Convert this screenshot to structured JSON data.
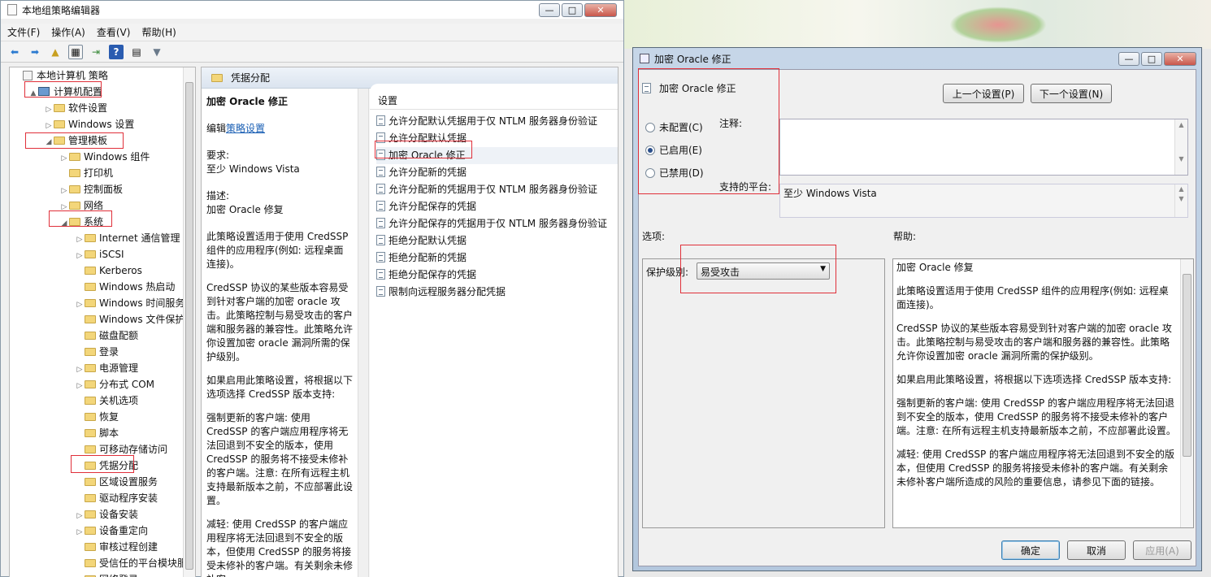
{
  "left_window": {
    "title": "本地组策略编辑器",
    "menu": [
      "文件(F)",
      "操作(A)",
      "查看(V)",
      "帮助(H)"
    ]
  },
  "tree": {
    "items": [
      {
        "label": "本地计算机 策略",
        "level": 0,
        "exp": ""
      },
      {
        "label": "计算机配置",
        "level": 1,
        "exp": "▲"
      },
      {
        "label": "软件设置",
        "level": 2,
        "exp": "▷"
      },
      {
        "label": "Windows 设置",
        "level": 2,
        "exp": "▷"
      },
      {
        "label": "管理模板",
        "level": 2,
        "exp": "◢"
      },
      {
        "label": "Windows 组件",
        "level": 3,
        "exp": "▷"
      },
      {
        "label": "打印机",
        "level": 3,
        "exp": ""
      },
      {
        "label": "控制面板",
        "level": 3,
        "exp": "▷"
      },
      {
        "label": "网络",
        "level": 3,
        "exp": "▷"
      },
      {
        "label": "系统",
        "level": 3,
        "exp": "◢"
      },
      {
        "label": "Internet 通信管理",
        "level": 4,
        "exp": "▷"
      },
      {
        "label": "iSCSI",
        "level": 4,
        "exp": "▷"
      },
      {
        "label": "Kerberos",
        "level": 4,
        "exp": ""
      },
      {
        "label": "Windows 热启动",
        "level": 4,
        "exp": ""
      },
      {
        "label": "Windows 时间服务",
        "level": 4,
        "exp": "▷"
      },
      {
        "label": "Windows 文件保护",
        "level": 4,
        "exp": ""
      },
      {
        "label": "磁盘配额",
        "level": 4,
        "exp": ""
      },
      {
        "label": "登录",
        "level": 4,
        "exp": ""
      },
      {
        "label": "电源管理",
        "level": 4,
        "exp": "▷"
      },
      {
        "label": "分布式 COM",
        "level": 4,
        "exp": "▷"
      },
      {
        "label": "关机选项",
        "level": 4,
        "exp": ""
      },
      {
        "label": "恢复",
        "level": 4,
        "exp": ""
      },
      {
        "label": "脚本",
        "level": 4,
        "exp": ""
      },
      {
        "label": "可移动存储访问",
        "level": 4,
        "exp": ""
      },
      {
        "label": "凭据分配",
        "level": 4,
        "exp": ""
      },
      {
        "label": "区域设置服务",
        "level": 4,
        "exp": ""
      },
      {
        "label": "驱动程序安装",
        "level": 4,
        "exp": ""
      },
      {
        "label": "设备安装",
        "level": 4,
        "exp": "▷"
      },
      {
        "label": "设备重定向",
        "level": 4,
        "exp": "▷"
      },
      {
        "label": "审核过程创建",
        "level": 4,
        "exp": ""
      },
      {
        "label": "受信任的平台模块服务",
        "level": 4,
        "exp": ""
      },
      {
        "label": "网络登录",
        "level": 4,
        "exp": "▷"
      }
    ]
  },
  "middle": {
    "header": "凭据分配",
    "policy_title": "加密 Oracle 修正",
    "edit_prefix": "编辑",
    "edit_link": "策略设置",
    "req_label": "要求:",
    "req_value": "至少 Windows Vista",
    "desc_label": "描述:",
    "desc_value": "加密 Oracle 修复",
    "paragraphs": [
      "此策略设置适用于使用 CredSSP 组件的应用程序(例如: 远程桌面连接)。",
      "CredSSP 协议的某些版本容易受到针对客户端的加密 oracle 攻击。此策略控制与易受攻击的客户端和服务器的兼容性。此策略允许你设置加密 oracle 漏洞所需的保护级别。",
      "如果启用此策略设置，将根据以下选项选择 CredSSP 版本支持:",
      "强制更新的客户端: 使用 CredSSP 的客户端应用程序将无法回退到不安全的版本，使用 CredSSP 的服务将不接受未修补的客户端。注意: 在所有远程主机支持最新版本之前，不应部署此设置。",
      "减轻: 使用 CredSSP 的客户端应用程序将无法回退到不安全的版本，但使用 CredSSP 的服务将接受未修补的客户端。有关剩余未修补客"
    ]
  },
  "settings": {
    "header": "设置",
    "items": [
      "允许分配默认凭据用于仅 NTLM 服务器身份验证",
      "允许分配默认凭据",
      "加密 Oracle 修正",
      "允许分配新的凭据",
      "允许分配新的凭据用于仅 NTLM 服务器身份验证",
      "允许分配保存的凭据",
      "允许分配保存的凭据用于仅 NTLM 服务器身份验证",
      "拒绝分配默认凭据",
      "拒绝分配新的凭据",
      "拒绝分配保存的凭据",
      "限制向远程服务器分配凭据"
    ],
    "selected": 2
  },
  "dialog": {
    "title": "加密 Oracle 修正",
    "heading": "加密 Oracle 修正",
    "prev_button": "上一个设置(P)",
    "next_button": "下一个设置(N)",
    "radio_not_configured": "未配置(C)",
    "radio_enabled": "已启用(E)",
    "radio_disabled": "已禁用(D)",
    "comment_label": "注释:",
    "platform_label": "支持的平台:",
    "platform_value": "至少 Windows Vista",
    "options_label": "选项:",
    "help_label": "帮助:",
    "protection_label": "保护级别:",
    "protection_value": "易受攻击",
    "help_paragraphs": [
      "加密 Oracle 修复",
      "此策略设置适用于使用 CredSSP 组件的应用程序(例如: 远程桌面连接)。",
      "CredSSP 协议的某些版本容易受到针对客户端的加密 oracle 攻击。此策略控制与易受攻击的客户端和服务器的兼容性。此策略允许你设置加密 oracle 漏洞所需的保护级别。",
      "如果启用此策略设置，将根据以下选项选择 CredSSP 版本支持:",
      "强制更新的客户端: 使用 CredSSP 的客户端应用程序将无法回退到不安全的版本，使用 CredSSP 的服务将不接受未修补的客户端。注意: 在所有远程主机支持最新版本之前，不应部署此设置。",
      "减轻: 使用 CredSSP 的客户端应用程序将无法回退到不安全的版本，但使用 CredSSP 的服务将接受未修补的客户端。有关剩余未修补客户端所造成的风险的重要信息，请参见下面的链接。"
    ],
    "ok": "确定",
    "cancel": "取消",
    "apply": "应用(A)"
  }
}
